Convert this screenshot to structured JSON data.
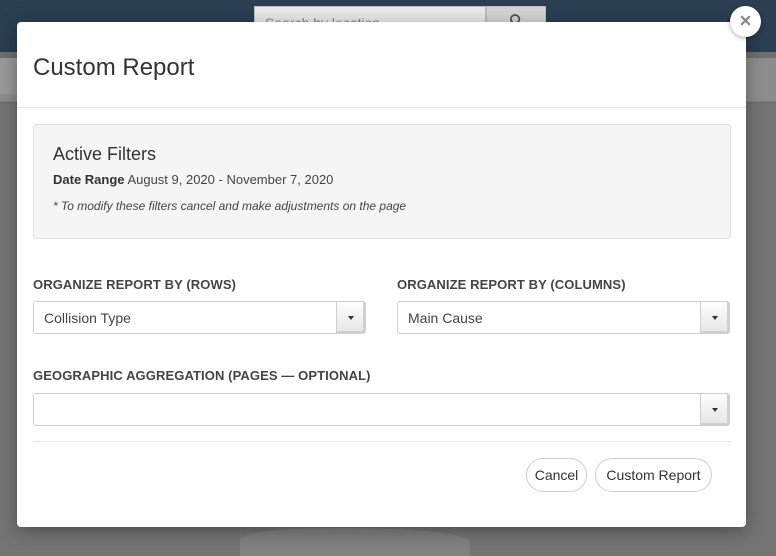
{
  "background": {
    "search_placeholder": "Search by location"
  },
  "modal": {
    "title": "Custom Report",
    "close_glyph": "✕",
    "active_filters": {
      "title": "Active Filters",
      "date_range_label": "Date Range",
      "date_range_value": "August 9, 2020 - November 7, 2020",
      "note": "* To modify these filters cancel and make adjustments on the page"
    },
    "rows": {
      "label": "ORGANIZE REPORT BY (ROWS)",
      "value": "Collision Type"
    },
    "columns": {
      "label": "ORGANIZE REPORT BY (COLUMNS)",
      "value": "Main Cause"
    },
    "geo": {
      "label": "GEOGRAPHIC AGGREGATION (PAGES — OPTIONAL)",
      "value": ""
    },
    "buttons": {
      "cancel": "Cancel",
      "submit": "Custom Report"
    }
  }
}
